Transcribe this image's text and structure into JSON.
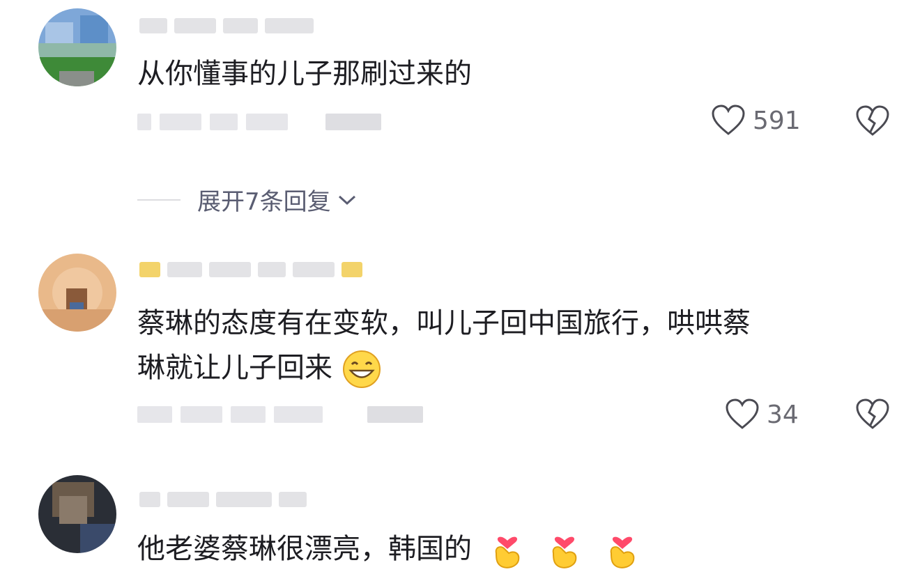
{
  "comments": [
    {
      "text": "从你懂事的儿子那刷过来的",
      "likes": "591",
      "replies_label": "展开7条回复"
    },
    {
      "text_line1": "蔡琳的态度有在变软，叫儿子回中国旅行，哄哄蔡",
      "text_line2": "琳就让儿子回来",
      "likes": "34",
      "emoji": "grinning-face"
    },
    {
      "text": "他老婆蔡琳很漂亮，韩国的",
      "emoji": "heart-hands"
    }
  ],
  "icons": {
    "like": "heart-outline-icon",
    "dislike": "broken-heart-icon",
    "expand": "chevron-down-icon"
  },
  "colors": {
    "text": "#1d1d22",
    "secondary": "#6a6a72",
    "link": "#5a5d72"
  }
}
